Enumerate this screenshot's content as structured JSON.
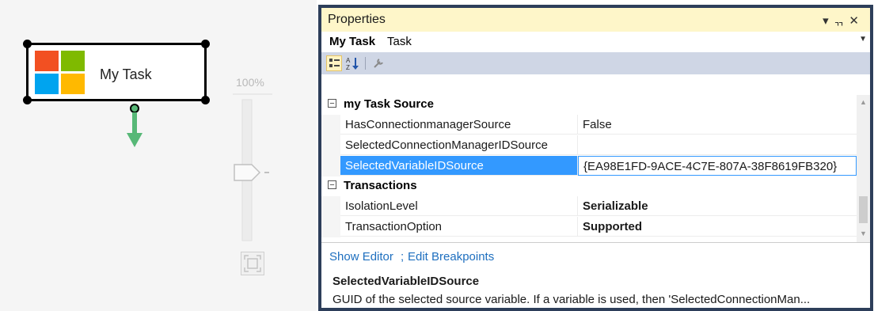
{
  "designer": {
    "task_name": "My Task",
    "zoom_level": "100%"
  },
  "properties": {
    "window_title": "Properties",
    "object_name": "My Task",
    "object_type": "Task",
    "categories": [
      {
        "label": "my Task Source",
        "rows": [
          {
            "name": "HasConnectionmanagerSource",
            "value": "False"
          },
          {
            "name": "SelectedConnectionManagerIDSource",
            "value": ""
          },
          {
            "name": "SelectedVariableIDSource",
            "value": "{EA98E1FD-9ACE-4C7E-807A-38F8619FB320}"
          }
        ]
      },
      {
        "label": "Transactions",
        "rows": [
          {
            "name": "IsolationLevel",
            "value": "Serializable"
          },
          {
            "name": "TransactionOption",
            "value": "Supported"
          }
        ]
      }
    ],
    "commands": {
      "show_editor": "Show Editor",
      "separator": ";",
      "edit_breakpoints": "Edit Breakpoints"
    },
    "description": {
      "title": "SelectedVariableIDSource",
      "text": "GUID of the selected source variable. If a variable is used, then 'SelectedConnectionMan..."
    }
  },
  "colors": {
    "title_bar": "#fef6c9",
    "window_border": "#2d3e5a",
    "toolbar": "#cfd6e5",
    "selection": "#3399ff",
    "link": "#1e6fbf",
    "ms_red": "#f25022",
    "ms_green": "#7fba00",
    "ms_blue": "#00a4ef",
    "ms_yellow": "#ffb900",
    "connector_green": "#57b877"
  },
  "icons": [
    "microsoft-logo-icon",
    "arrow-down-icon",
    "zoom-slider-thumb-icon",
    "fit-to-window-icon",
    "dropdown-icon",
    "pin-icon",
    "close-icon",
    "categorized-icon",
    "alphabetical-icon",
    "property-pages-icon"
  ]
}
